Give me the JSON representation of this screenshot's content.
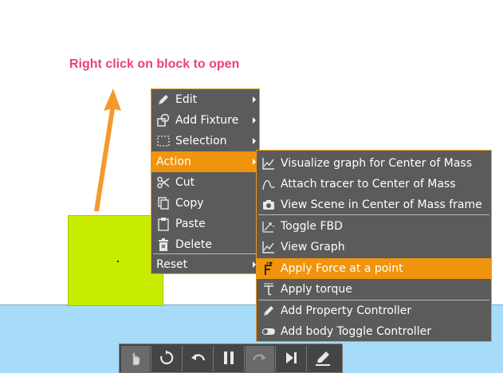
{
  "annotation": "Right click on block to open",
  "colors": {
    "menu_bg": "#5b5b5b",
    "menu_border": "#ee9a21",
    "highlight": "#f0940d",
    "block": "#c8ec00",
    "water": "#a6dcf9",
    "annotation": "#ee3f7a",
    "arrow": "#f49a2c"
  },
  "context_menu": {
    "items": [
      {
        "label": "Edit",
        "icon": "pencil-icon",
        "submenu": true
      },
      {
        "label": "Add Fixture",
        "icon": "fixture-icon",
        "submenu": true
      },
      {
        "label": "Selection",
        "icon": "selection-icon",
        "submenu": true
      },
      {
        "label": "Action",
        "submenu": true,
        "highlighted": true
      },
      {
        "label": "Cut",
        "icon": "scissors-icon"
      },
      {
        "label": "Copy",
        "icon": "copy-icon"
      },
      {
        "label": "Paste",
        "icon": "clipboard-icon"
      },
      {
        "label": "Delete",
        "icon": "trash-icon"
      },
      {
        "label": "Reset",
        "submenu": true
      }
    ]
  },
  "action_submenu": {
    "items": [
      {
        "label": "Visualize graph for Center of  Mass",
        "icon": "graph-icon"
      },
      {
        "label": "Attach tracer to Center of  Mass",
        "icon": "tracer-icon"
      },
      {
        "label": "View Scene in Center of Mass frame",
        "icon": "camera-icon"
      },
      {
        "label": "Toggle FBD",
        "icon": "fbd-icon"
      },
      {
        "label": "View Graph",
        "icon": "graph-icon"
      },
      {
        "label": "Apply Force at a point",
        "icon": "force-icon",
        "highlighted": true
      },
      {
        "label": "Apply torque",
        "icon": "torque-icon"
      },
      {
        "label": "Add Property Controller",
        "icon": "pencil-icon"
      },
      {
        "label": "Add body Toggle Controller",
        "icon": "toggle-icon"
      }
    ]
  },
  "toolbar": {
    "buttons": [
      {
        "name": "hand-tool",
        "icon": "hand-icon",
        "active": true
      },
      {
        "name": "reset",
        "icon": "reset-icon"
      },
      {
        "name": "undo",
        "icon": "undo-icon"
      },
      {
        "name": "pause",
        "icon": "pause-icon"
      },
      {
        "name": "redo",
        "icon": "redo-icon",
        "active": true
      },
      {
        "name": "step",
        "icon": "step-forward-icon"
      },
      {
        "name": "edit",
        "icon": "edit-icon"
      }
    ]
  }
}
